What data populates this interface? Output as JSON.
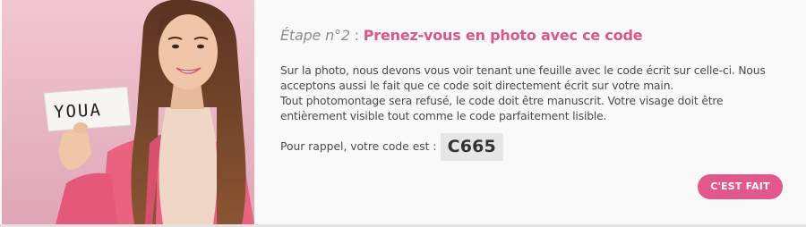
{
  "step": {
    "prefix": "Étape n°2",
    "separator": " : ",
    "title": "Prenez-vous en photo avec ce code"
  },
  "instructions": {
    "line1": "Sur la photo, nous devons vous voir tenant une feuille avec le code écrit sur celle-ci. Nous acceptons aussi le fait que ce code soit directement écrit sur votre main.",
    "line2": "Tout photomontage sera refusé, le code doit être manuscrit. Votre visage doit être entièrement visible tout comme le code parfaitement lisible."
  },
  "reminder": {
    "label": "Pour rappel, votre code est :",
    "code": "C665"
  },
  "actions": {
    "done_label": "C'EST FAIT"
  },
  "example_photo": {
    "sign_text": "YOUA"
  },
  "colors": {
    "accent": "#e2578c",
    "title_accent": "#d9588a",
    "text": "#4a4a4a",
    "muted": "#8e8e8e",
    "code_bg": "#e6e6e6"
  }
}
